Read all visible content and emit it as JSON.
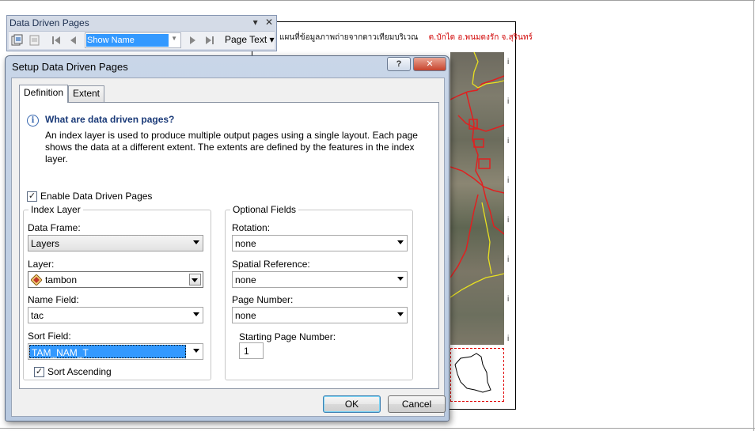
{
  "layout_page": {
    "title": "แผนที่ข้อมูลภาพถ่ายจากดาวเทียมบริเวณ",
    "subtitle": "ต.บักได อ.พนมดงรัก จ.สุรินทร์",
    "side_marker": "i"
  },
  "toolbar": {
    "title": "Data Driven Pages",
    "page_combo_value": "Show Name",
    "page_text_label": "Page Text",
    "page_text_arrow": "▾",
    "dropdown_glyph": "▾",
    "close_glyph": "✕"
  },
  "dialog": {
    "title": "Setup Data Driven Pages",
    "help_label": "?",
    "close_label": "✕",
    "tabs": [
      {
        "label": "Definition",
        "selected": true
      },
      {
        "label": "Extent",
        "selected": false
      }
    ],
    "info_icon": "i",
    "info_heading": "What are data driven pages?",
    "info_text": "An index layer is used to produce multiple output pages using a single layout.  Each page shows the data at a different extent.  The extents are defined by the features in the index layer.",
    "enable": {
      "label": "Enable Data Driven Pages",
      "checked": true,
      "mark": "✓"
    },
    "index_layer": {
      "legend": "Index Layer",
      "data_frame_label": "Data Frame:",
      "data_frame_value": "Layers",
      "layer_label": "Layer:",
      "layer_value": "tambon",
      "name_field_label": "Name Field:",
      "name_field_value": "tac",
      "sort_field_label": "Sort Field:",
      "sort_field_value": "TAM_NAM_T",
      "sort_ascending": {
        "label": "Sort Ascending",
        "checked": true,
        "mark": "✓"
      }
    },
    "optional_fields": {
      "legend": "Optional Fields",
      "rotation_label": "Rotation:",
      "rotation_value": "none",
      "spatial_ref_label": "Spatial Reference:",
      "spatial_ref_value": "none",
      "page_number_label": "Page Number:",
      "page_number_value": "none",
      "starting_page_label": "Starting Page Number:",
      "starting_page_value": "1"
    },
    "ok_label": "OK",
    "cancel_label": "Cancel"
  },
  "colors": {
    "accent_selection": "#3399ff",
    "heading_blue": "#1a3a78",
    "map_red_text": "#d00000",
    "close_button": "#c7432c"
  },
  "icons": [
    "setup-pages-icon",
    "export-pages-icon",
    "first-page-icon",
    "previous-page-icon",
    "next-page-icon",
    "last-page-icon",
    "info-icon",
    "polygon-layer-icon",
    "chevron-down-icon"
  ]
}
